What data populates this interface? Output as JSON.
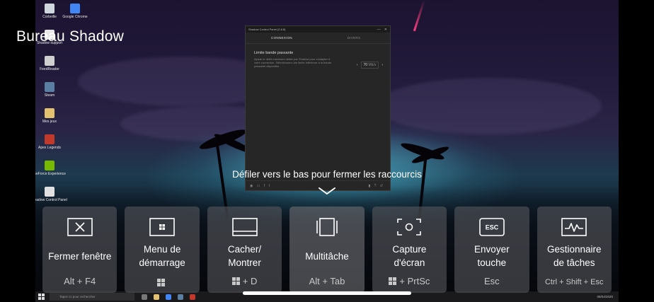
{
  "header": {
    "title": "Bureau Shadow"
  },
  "hint": {
    "text": "Défiler vers le bas pour fermer les raccourcis"
  },
  "desktop_icons": [
    {
      "label": "Corbeille",
      "icon": "recycle-bin-icon",
      "color": "#cfd6dd"
    },
    {
      "label": "Shadow support",
      "icon": "shadow-support-icon",
      "color": "#e8e8e8"
    },
    {
      "label": "FeedReader",
      "icon": "feedreader-icon",
      "color": "#cfcfcf"
    },
    {
      "label": "Steam",
      "icon": "steam-icon",
      "color": "#5b7fa3"
    },
    {
      "label": "Mes jeux",
      "icon": "folder-icon",
      "color": "#e3c16f"
    },
    {
      "label": "Apex Legends",
      "icon": "apex-icon",
      "color": "#c0392b"
    },
    {
      "label": "GeForce Experience",
      "icon": "geforce-icon",
      "color": "#76b900"
    },
    {
      "label": "Shadow Control Panel",
      "icon": "shadow-control-icon",
      "color": "#e0e0e0"
    }
  ],
  "desktop_icons_col2": [
    {
      "label": "Google Chrome",
      "icon": "chrome-icon",
      "color": "#4285f4"
    }
  ],
  "control_panel": {
    "title": "Shadow Control Panel (2.6.8)",
    "tabs": [
      "CONNEXION",
      "DIVERS"
    ],
    "section_title": "Limite bande passante",
    "section_desc": "Ajuste le débit maximum utilisé par Shadow pour s'adapter à votre connexion. Sélectionnez une limite inférieure à la bande passante disponible.",
    "bandwidth_value": "70",
    "bandwidth_unit": "Mb/s"
  },
  "shortcuts": [
    {
      "label": "Fermer fenêtre",
      "keys": "Alt + F4",
      "icon": "close-window-icon",
      "win_key": false
    },
    {
      "label": "Menu de démarrage",
      "keys": "",
      "icon": "start-menu-icon",
      "win_key": true
    },
    {
      "label": "Cacher/ Montrer",
      "keys": "+ D",
      "icon": "show-desktop-icon",
      "win_key": true
    },
    {
      "label": "Multitâche",
      "keys": "Alt + Tab",
      "icon": "multitask-icon",
      "win_key": false
    },
    {
      "label": "Capture d'écran",
      "keys": "+ PrtSc",
      "icon": "screenshot-icon",
      "win_key": true
    },
    {
      "label": "Envoyer touche",
      "keys": "Esc",
      "icon": "esc-key-icon",
      "win_key": false
    },
    {
      "label": "Gestionnaire de tâches",
      "keys": "Ctrl + Shift + Esc",
      "icon": "task-manager-icon",
      "win_key": false
    }
  ],
  "taskbar": {
    "search_placeholder": "Tapez ici pour rechercher",
    "clock_date": "08/04/2020"
  },
  "colors": {
    "card_bg": "#5f5f64",
    "card_active_bg": "#6e6e73",
    "accent_meteor": "#ff3d7f"
  }
}
